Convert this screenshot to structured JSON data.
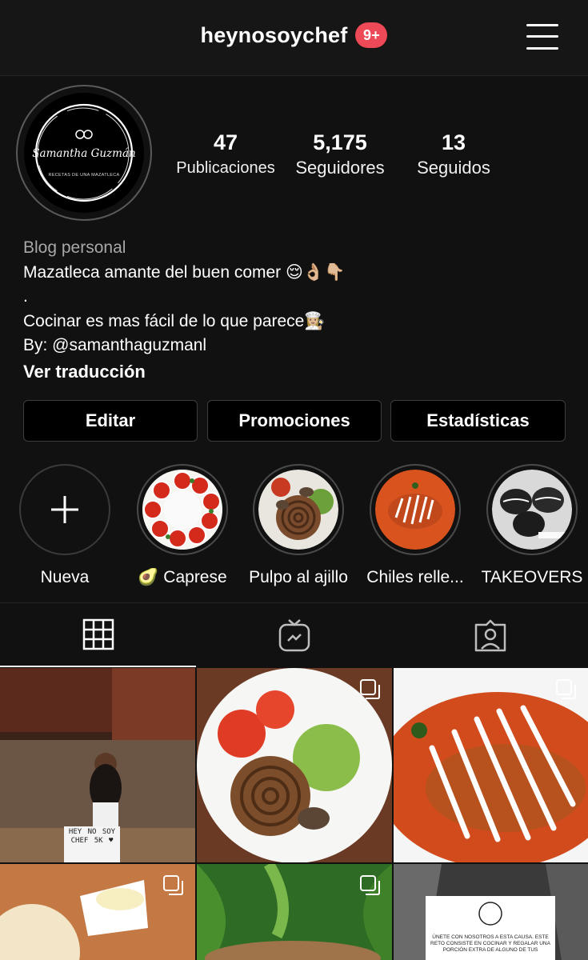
{
  "header": {
    "username": "heynosoychef",
    "notification_badge": "9+",
    "menu_icon": "hamburger-menu-icon"
  },
  "profile": {
    "avatar": {
      "logo_text": "Samantha Guzmán",
      "logo_subtitle": "RECETAS DE UNA MAZATLECA"
    },
    "stats": [
      {
        "value": "47",
        "label": "Publicaciones"
      },
      {
        "value": "5,175",
        "label": "Seguidores"
      },
      {
        "value": "13",
        "label": "Seguidos"
      }
    ],
    "bio": {
      "category": "Blog personal",
      "line1": "Mazatleca amante del buen comer 😌👌🏼👇🏼",
      "line2": ".",
      "line3": "Cocinar es mas fácil de lo que parece👩🏼‍🍳",
      "line4": "By: @samanthaguzmanl",
      "translate": "Ver traducción"
    }
  },
  "buttons": {
    "edit": "Editar",
    "promotions": "Promociones",
    "stats": "Estadísticas"
  },
  "highlights": [
    {
      "label": "Nueva",
      "icon": "plus-icon"
    },
    {
      "label": "🥑 Caprese"
    },
    {
      "label": "Pulpo al ajillo"
    },
    {
      "label": "Chiles relle..."
    },
    {
      "label": "TAKEOVERS"
    }
  ],
  "tabs": [
    {
      "icon": "grid-icon",
      "active": true
    },
    {
      "icon": "igtv-icon",
      "active": false
    },
    {
      "icon": "tagged-user-icon",
      "active": false
    }
  ],
  "posts": {
    "post1_sign": "HEY NO SOY CHEF 5K ♥",
    "post6_text": "ÚNETE CON NOSOTROS A ESTA CAUSA. ESTE RETO CONSISTE EN COCINAR Y REGALAR UNA PORCIÓN EXTRA DE ALGUNO DE TUS"
  },
  "colors": {
    "background": "#111111",
    "badge": "#ed4956",
    "button_bg": "#000000",
    "border": "#3d3d3d"
  }
}
